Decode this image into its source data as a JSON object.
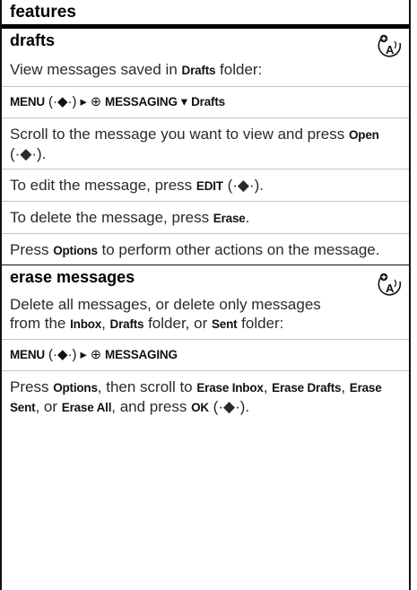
{
  "header": {
    "title": "features"
  },
  "drafts": {
    "title": "drafts",
    "icon": "network-feature-icon",
    "intro": [
      "View messages saved in ",
      "Drafts",
      " folder:"
    ],
    "path": {
      "menu": "MENU",
      "nav": "(·◆·)",
      "arrow": "▸",
      "item": "MESSAGING",
      "arrow2": "▾",
      "folder": "Drafts"
    },
    "scroll": [
      "Scroll to the message you want to view and press ",
      "Open",
      " (·◆·)."
    ],
    "edit": [
      "To edit the message, press ",
      "EDIT",
      " (·◆·)."
    ],
    "delete": [
      "To delete the message, press ",
      "Erase",
      "."
    ],
    "options": [
      "Press ",
      "Options",
      " to perform other actions on the message."
    ]
  },
  "erase": {
    "title": "erase messages",
    "icon": "network-feature-icon",
    "intro": [
      "Delete all messages, or delete only messages from the ",
      "Inbox",
      ", ",
      "Drafts",
      " folder, or ",
      "Sent",
      " folder:"
    ],
    "path": {
      "menu": "MENU",
      "nav": "(·◆·)",
      "arrow": "▸",
      "item": "MESSAGING"
    },
    "options": [
      "Press ",
      "Options",
      ", then scroll to ",
      "Erase Inbox",
      ", ",
      "Erase Drafts",
      ", ",
      "Erase Sent",
      ", or ",
      "Erase All",
      ", and press ",
      "OK",
      " (·◆·)."
    ]
  }
}
